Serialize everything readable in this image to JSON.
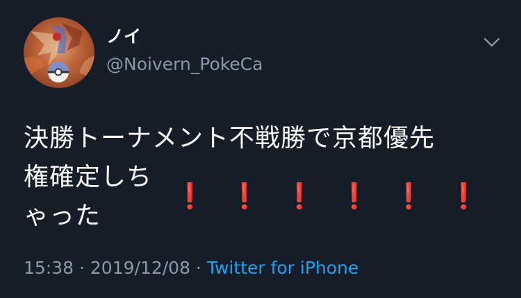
{
  "user": {
    "display_name": "ノイ",
    "handle": "@Noivern_PokeCa",
    "avatar": "avatar-icon"
  },
  "tweet": {
    "line1": "決勝トーナメント不戦勝で京都優先",
    "line2": "権確定しちゃった",
    "exclamations": "❗❗❗❗❗❗"
  },
  "meta": {
    "time": "15:38",
    "separator1": " · ",
    "date": "2019/12/08",
    "separator2": " · ",
    "source": "Twitter for iPhone"
  },
  "icons": {
    "menu": "chevron-down-icon"
  },
  "colors": {
    "background": "#151d29",
    "text": "#ffffff",
    "secondary": "#8b98a5",
    "link": "#1da1f2",
    "exclamation": "#e0182a"
  }
}
